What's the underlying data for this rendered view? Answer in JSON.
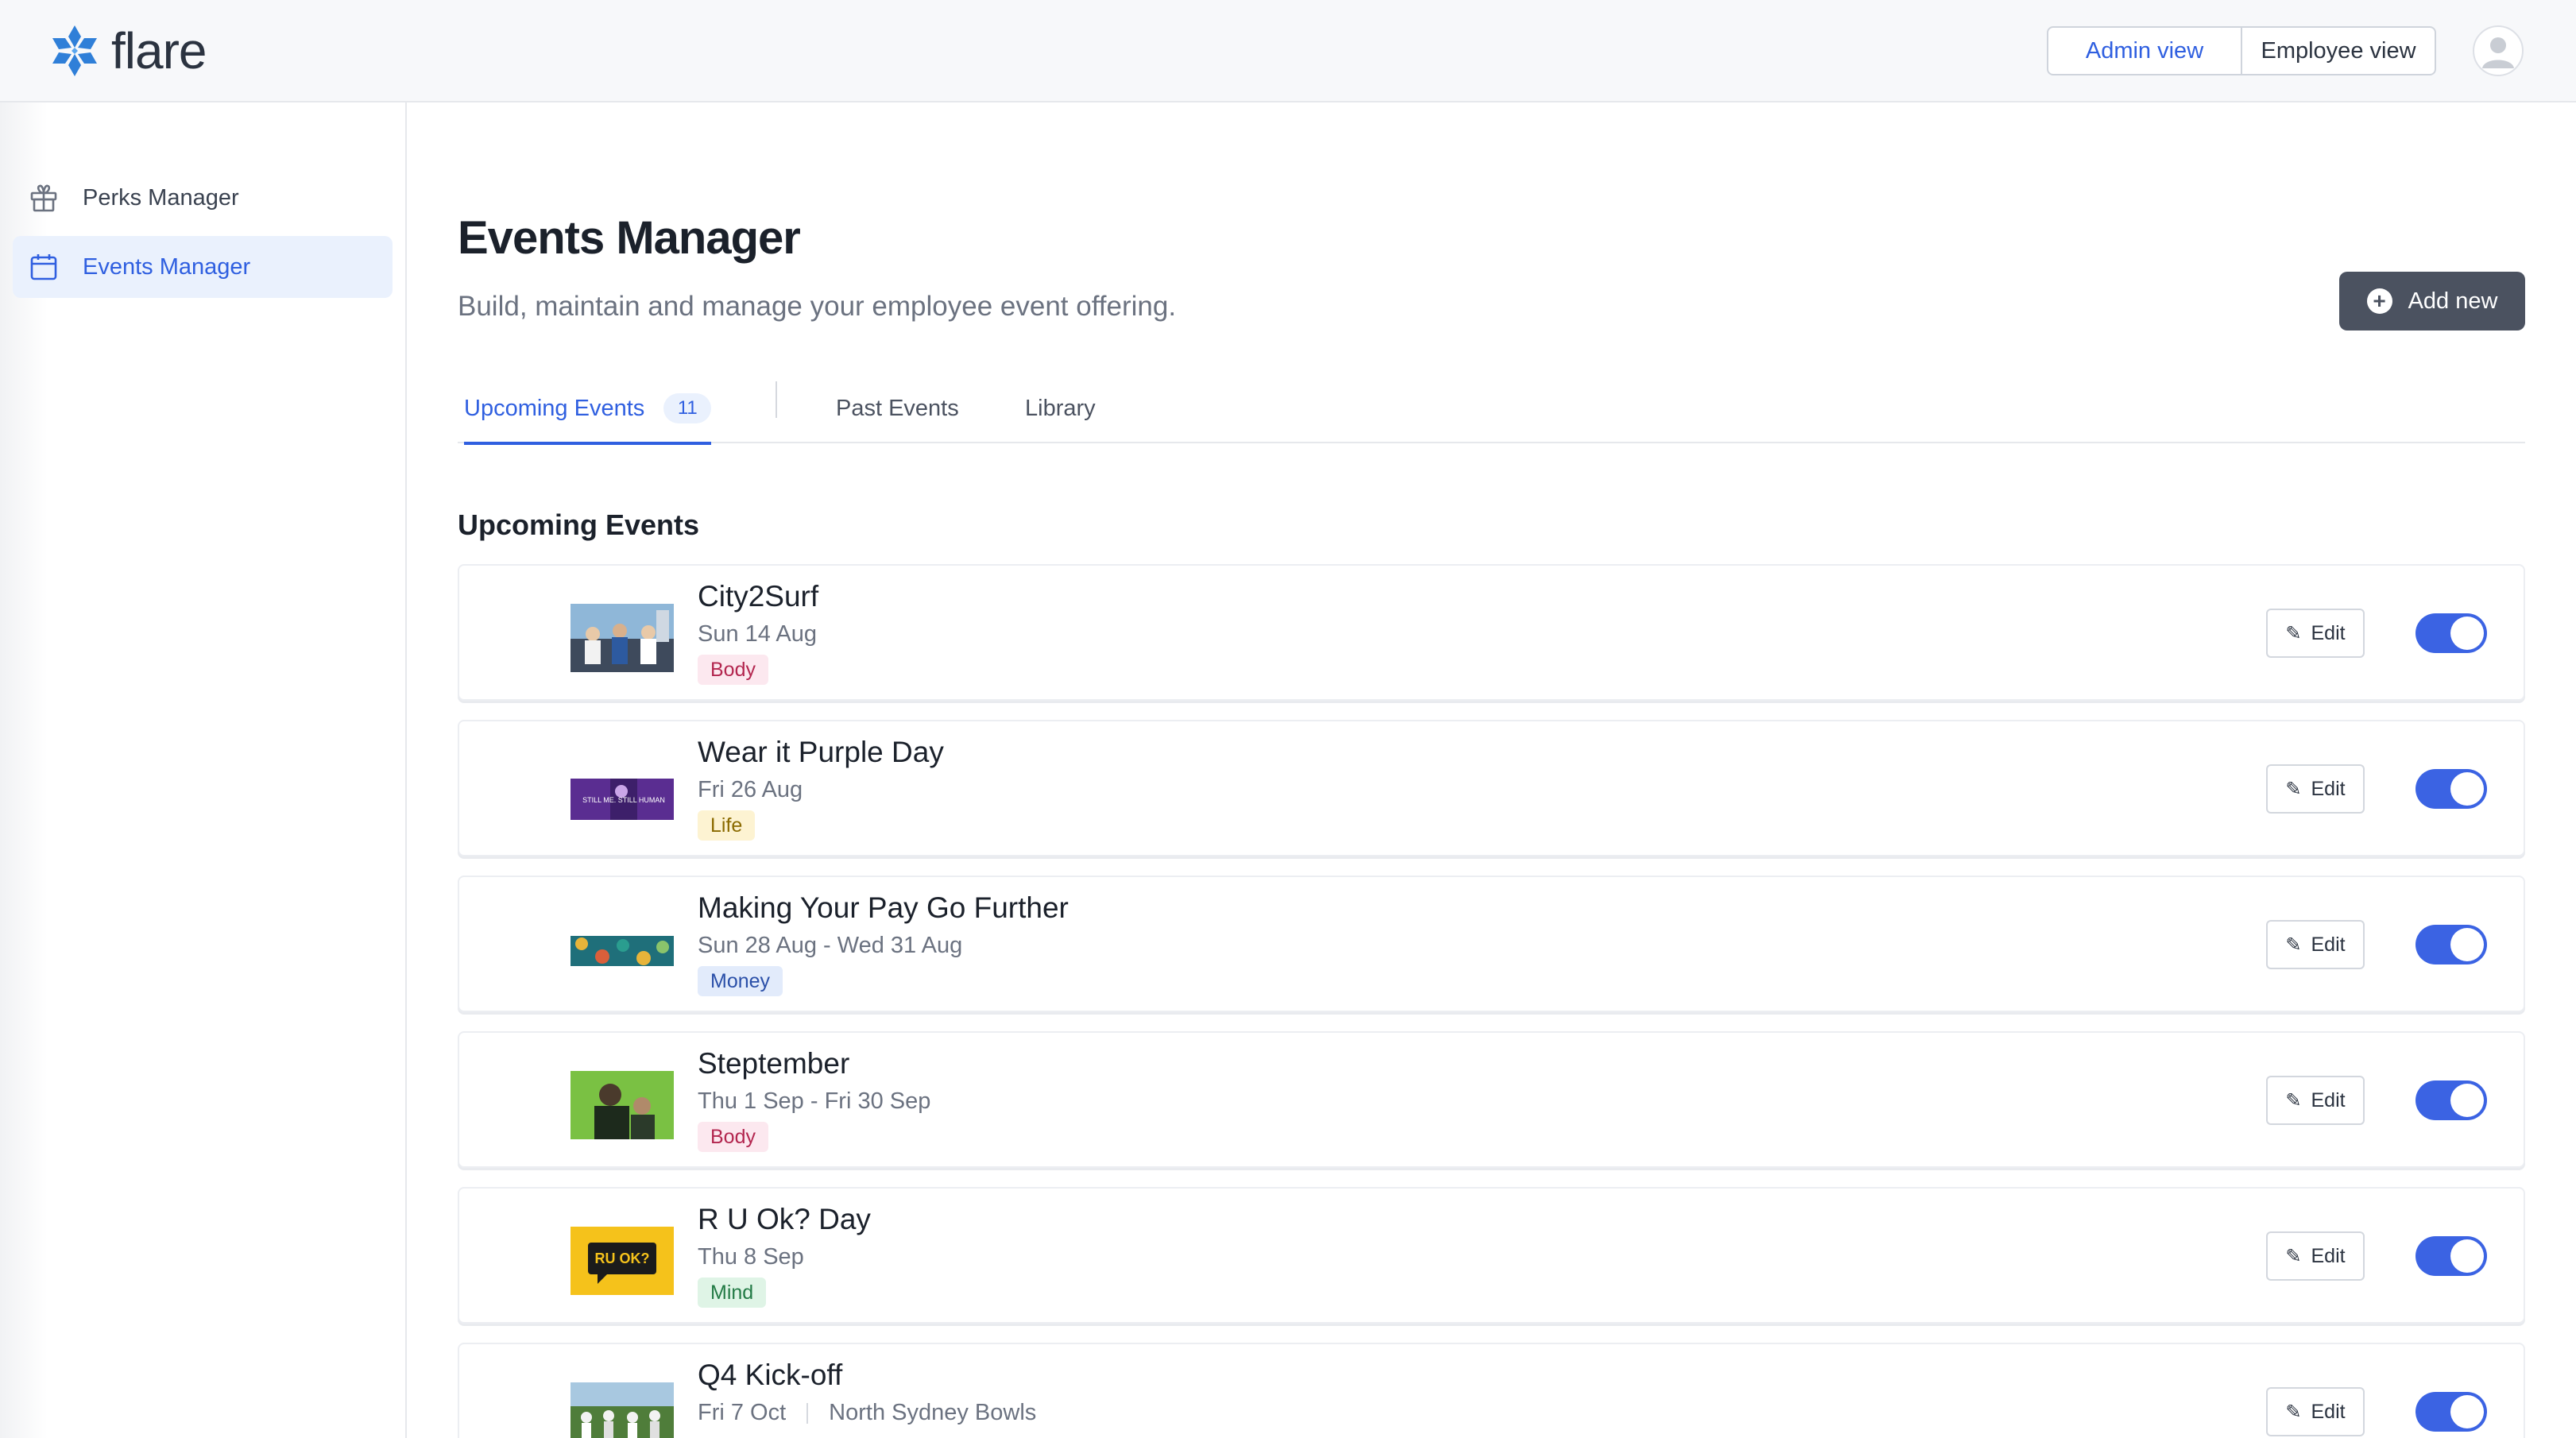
{
  "brand": {
    "name": "flare",
    "color": "#2f7fd8"
  },
  "header": {
    "views": [
      {
        "label": "Admin view",
        "active": true
      },
      {
        "label": "Employee view",
        "active": false
      }
    ],
    "avatar_icon": "user-avatar-icon"
  },
  "sidebar": {
    "items": [
      {
        "label": "Perks Manager",
        "icon": "gift-icon",
        "active": false
      },
      {
        "label": "Events Manager",
        "icon": "calendar-icon",
        "active": true
      }
    ]
  },
  "main": {
    "title": "Events Manager",
    "subtitle": "Build, maintain and manage your employee event offering.",
    "add_button": "Add new",
    "tabs": [
      {
        "label": "Upcoming Events",
        "count": "11",
        "active": true
      },
      {
        "label": "Past Events"
      },
      {
        "label": "Library"
      }
    ],
    "section_title": "Upcoming Events",
    "edit_label": "Edit",
    "events": [
      {
        "name": "City2Surf",
        "date": "Sun 14 Aug",
        "location": "",
        "tag": "Body",
        "tag_bg": "#fce8ef",
        "tag_fg": "#b3264f",
        "enabled": true
      },
      {
        "name": "Wear it Purple Day",
        "date": "Fri 26 Aug",
        "location": "",
        "tag": "Life",
        "tag_bg": "#fdf3d2",
        "tag_fg": "#8a6a00",
        "enabled": true
      },
      {
        "name": "Making Your Pay Go Further",
        "date": "Sun 28 Aug - Wed 31 Aug",
        "location": "",
        "tag": "Money",
        "tag_bg": "#e2ebfb",
        "tag_fg": "#2a4fa8",
        "enabled": true
      },
      {
        "name": "Steptember",
        "date": "Thu 1 Sep - Fri 30 Sep",
        "location": "",
        "tag": "Body",
        "tag_bg": "#fce8ef",
        "tag_fg": "#b3264f",
        "enabled": true
      },
      {
        "name": "R U Ok? Day",
        "date": "Thu 8 Sep",
        "location": "",
        "tag": "Mind",
        "tag_bg": "#dff4e6",
        "tag_fg": "#227a45",
        "enabled": true
      },
      {
        "name": "Q4 Kick-off",
        "date": "Fri 7 Oct",
        "location": "North Sydney Bowls",
        "tag": "",
        "tag_bg": "#fdf3d2",
        "tag_fg": "#8a6a00",
        "enabled": true
      }
    ],
    "thumb_texts": {
      "purple": "STILL ME. STILL HUMAN",
      "ruok": "RU OK?"
    }
  }
}
